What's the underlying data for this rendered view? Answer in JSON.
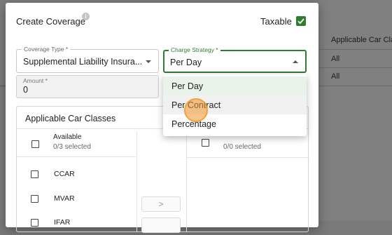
{
  "modal": {
    "title": "Create Coverage",
    "info_icon": "info-icon",
    "taxable_label": "Taxable",
    "taxable_checked": true
  },
  "coverage_type": {
    "label": "Coverage Type *",
    "value": "Supplemental Liability Insura..."
  },
  "charge_strategy": {
    "label": "Charge Strategy *",
    "value": "Per Day",
    "options": [
      "Per Day",
      "Per Contract",
      "Percentage"
    ]
  },
  "amount": {
    "label": "Amount *",
    "value": "0"
  },
  "car_classes": {
    "title": "Applicable Car Classes",
    "available": {
      "title": "Available",
      "count_text": "0/3 selected",
      "items": [
        "CCAR",
        "MVAR",
        "IFAR"
      ]
    },
    "selected": {
      "count_text": "0/0 selected"
    },
    "move_right_label": ">"
  },
  "background": {
    "column_header": "Applicable Car Cla",
    "rows": [
      "All",
      "All"
    ]
  },
  "colors": {
    "accent": "#2e7d32",
    "selected_option_bg": "#eaf3ea"
  }
}
